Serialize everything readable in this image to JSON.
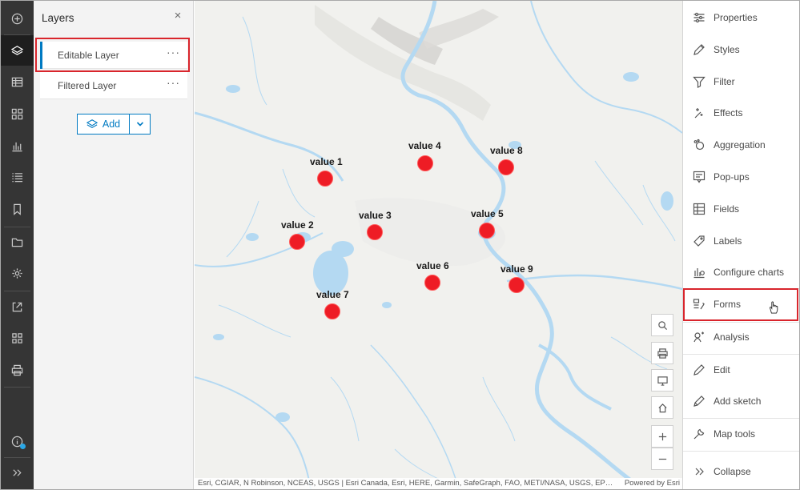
{
  "toolbar_left": {
    "items": [
      {
        "icon": "add-circle-icon"
      },
      {
        "icon": "layers-icon",
        "active": true
      },
      {
        "icon": "table-icon"
      },
      {
        "icon": "basemap-grid-icon"
      },
      {
        "icon": "chart-icon"
      },
      {
        "icon": "legend-list-icon"
      },
      {
        "icon": "bookmark-icon"
      },
      {
        "icon": "folder-icon"
      },
      {
        "icon": "gear-icon"
      },
      {
        "icon": "share-icon"
      },
      {
        "icon": "apps-grid-icon"
      },
      {
        "icon": "print-icon"
      },
      {
        "icon": "info-icon"
      },
      {
        "icon": "expand-chevrons-icon"
      }
    ],
    "info_badge_color": "#2aa7e6"
  },
  "layers_panel": {
    "title": "Layers",
    "close_symbol": "×",
    "layers": [
      {
        "label": "Editable Layer",
        "more": "···",
        "selected": true
      },
      {
        "label": "Filtered Layer",
        "more": "···",
        "selected": false
      }
    ],
    "add_label": "Add"
  },
  "map": {
    "points": [
      {
        "label": "value 1"
      },
      {
        "label": "value 2"
      },
      {
        "label": "value 3"
      },
      {
        "label": "value 4"
      },
      {
        "label": "value 5"
      },
      {
        "label": "value 6"
      },
      {
        "label": "value 7"
      },
      {
        "label": "value 8"
      },
      {
        "label": "value 9"
      }
    ],
    "point_color": "#ee1c25",
    "water_color": "#b4d9f2",
    "land_color": "#f1f1ee",
    "attribution": "Esri, CGIAR, N Robinson, NCEAS, USGS | Esri Canada, Esri, HERE, Garmin, SafeGraph, FAO, METI/NASA, USGS, EP…",
    "powered_by": "Powered by Esri",
    "tools": [
      "search-icon",
      "print-screen-icon",
      "monitor-icon",
      "home-icon",
      "zoom-in-icon",
      "zoom-out-icon"
    ],
    "zoom_in": "+",
    "zoom_out": "−"
  },
  "settings_panel": {
    "items": [
      {
        "label": "Properties",
        "icon": "sliders-icon"
      },
      {
        "label": "Styles",
        "icon": "styles-icon"
      },
      {
        "label": "Filter",
        "icon": "filter-icon"
      },
      {
        "label": "Effects",
        "icon": "effects-icon"
      },
      {
        "label": "Aggregation",
        "icon": "aggregation-icon"
      },
      {
        "label": "Pop-ups",
        "icon": "popup-icon"
      },
      {
        "label": "Fields",
        "icon": "fields-icon"
      },
      {
        "label": "Labels",
        "icon": "label-icon"
      },
      {
        "label": "Configure charts",
        "icon": "chart-config-icon"
      },
      {
        "label": "Forms",
        "icon": "forms-icon",
        "highlighted": true
      },
      {
        "label": "Analysis",
        "icon": "analysis-icon"
      },
      {
        "label": "Edit",
        "icon": "pencil-icon"
      },
      {
        "label": "Add sketch",
        "icon": "sketch-icon"
      },
      {
        "label": "Map tools",
        "icon": "wrench-icon"
      },
      {
        "label": "Collapse",
        "icon": "chevrons-right-icon"
      }
    ]
  },
  "highlight_color": "#d9252c",
  "accent_color": "#007ac2"
}
